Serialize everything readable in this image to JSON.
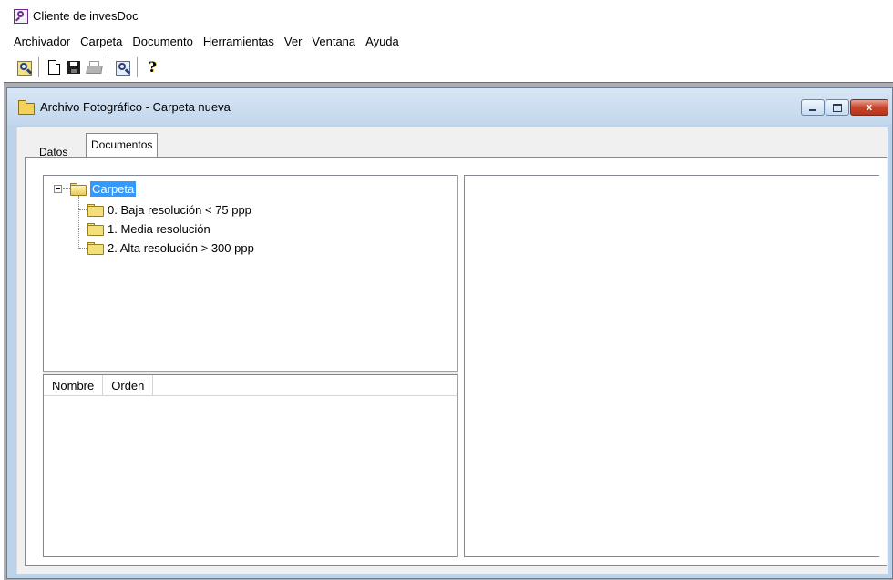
{
  "app": {
    "title": "Cliente de invesDoc"
  },
  "menu": [
    "Archivador",
    "Carpeta",
    "Documento",
    "Herramientas",
    "Ver",
    "Ventana",
    "Ayuda"
  ],
  "toolbar": {
    "icons": [
      "search-icon",
      "new-document-icon",
      "save-icon",
      "print-icon",
      "preview-icon",
      "help-icon"
    ],
    "help_glyph": "?"
  },
  "child_window": {
    "title": "Archivo Fotográfico - Carpeta nueva",
    "close_glyph": "x"
  },
  "tabs": [
    {
      "label": "Datos",
      "selected": false
    },
    {
      "label": "Documentos",
      "selected": true
    }
  ],
  "tree": {
    "root": {
      "label": "Carpeta",
      "expanded": true,
      "selected": true
    },
    "children": [
      "0. Baja resolución < 75 ppp",
      "1. Media resolución",
      "2. Alta resolución > 300 ppp"
    ]
  },
  "list": {
    "columns": [
      "Nombre",
      "Orden"
    ],
    "rows": []
  },
  "colors": {
    "selection": "#3399ff",
    "title_gradient": "#c3d6ec",
    "close_button": "#c7452d"
  }
}
